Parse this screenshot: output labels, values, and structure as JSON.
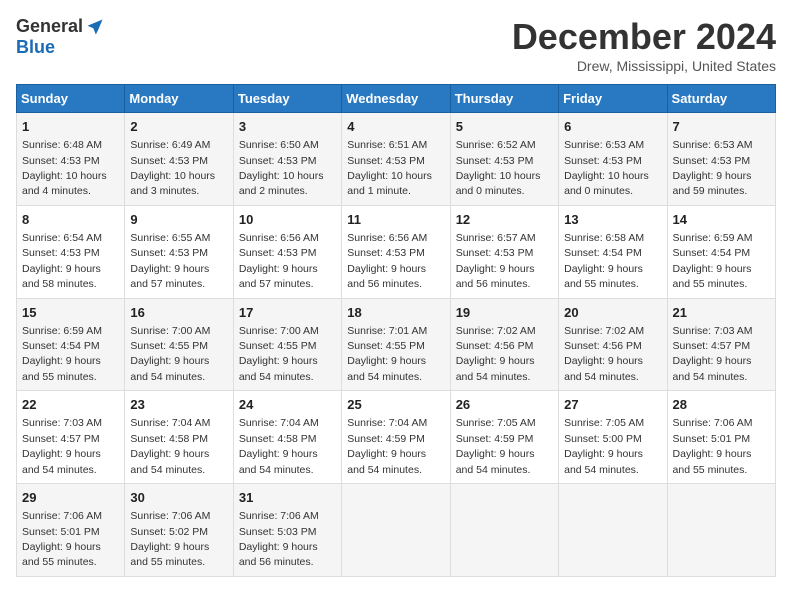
{
  "header": {
    "logo_general": "General",
    "logo_blue": "Blue",
    "month_title": "December 2024",
    "location": "Drew, Mississippi, United States"
  },
  "days_of_week": [
    "Sunday",
    "Monday",
    "Tuesday",
    "Wednesday",
    "Thursday",
    "Friday",
    "Saturday"
  ],
  "weeks": [
    [
      {
        "day": "1",
        "sunrise": "6:48 AM",
        "sunset": "4:53 PM",
        "daylight": "10 hours and 4 minutes."
      },
      {
        "day": "2",
        "sunrise": "6:49 AM",
        "sunset": "4:53 PM",
        "daylight": "10 hours and 3 minutes."
      },
      {
        "day": "3",
        "sunrise": "6:50 AM",
        "sunset": "4:53 PM",
        "daylight": "10 hours and 2 minutes."
      },
      {
        "day": "4",
        "sunrise": "6:51 AM",
        "sunset": "4:53 PM",
        "daylight": "10 hours and 1 minute."
      },
      {
        "day": "5",
        "sunrise": "6:52 AM",
        "sunset": "4:53 PM",
        "daylight": "10 hours and 0 minutes."
      },
      {
        "day": "6",
        "sunrise": "6:53 AM",
        "sunset": "4:53 PM",
        "daylight": "10 hours and 0 minutes."
      },
      {
        "day": "7",
        "sunrise": "6:53 AM",
        "sunset": "4:53 PM",
        "daylight": "9 hours and 59 minutes."
      }
    ],
    [
      {
        "day": "8",
        "sunrise": "6:54 AM",
        "sunset": "4:53 PM",
        "daylight": "9 hours and 58 minutes."
      },
      {
        "day": "9",
        "sunrise": "6:55 AM",
        "sunset": "4:53 PM",
        "daylight": "9 hours and 57 minutes."
      },
      {
        "day": "10",
        "sunrise": "6:56 AM",
        "sunset": "4:53 PM",
        "daylight": "9 hours and 57 minutes."
      },
      {
        "day": "11",
        "sunrise": "6:56 AM",
        "sunset": "4:53 PM",
        "daylight": "9 hours and 56 minutes."
      },
      {
        "day": "12",
        "sunrise": "6:57 AM",
        "sunset": "4:53 PM",
        "daylight": "9 hours and 56 minutes."
      },
      {
        "day": "13",
        "sunrise": "6:58 AM",
        "sunset": "4:54 PM",
        "daylight": "9 hours and 55 minutes."
      },
      {
        "day": "14",
        "sunrise": "6:59 AM",
        "sunset": "4:54 PM",
        "daylight": "9 hours and 55 minutes."
      }
    ],
    [
      {
        "day": "15",
        "sunrise": "6:59 AM",
        "sunset": "4:54 PM",
        "daylight": "9 hours and 55 minutes."
      },
      {
        "day": "16",
        "sunrise": "7:00 AM",
        "sunset": "4:55 PM",
        "daylight": "9 hours and 54 minutes."
      },
      {
        "day": "17",
        "sunrise": "7:00 AM",
        "sunset": "4:55 PM",
        "daylight": "9 hours and 54 minutes."
      },
      {
        "day": "18",
        "sunrise": "7:01 AM",
        "sunset": "4:55 PM",
        "daylight": "9 hours and 54 minutes."
      },
      {
        "day": "19",
        "sunrise": "7:02 AM",
        "sunset": "4:56 PM",
        "daylight": "9 hours and 54 minutes."
      },
      {
        "day": "20",
        "sunrise": "7:02 AM",
        "sunset": "4:56 PM",
        "daylight": "9 hours and 54 minutes."
      },
      {
        "day": "21",
        "sunrise": "7:03 AM",
        "sunset": "4:57 PM",
        "daylight": "9 hours and 54 minutes."
      }
    ],
    [
      {
        "day": "22",
        "sunrise": "7:03 AM",
        "sunset": "4:57 PM",
        "daylight": "9 hours and 54 minutes."
      },
      {
        "day": "23",
        "sunrise": "7:04 AM",
        "sunset": "4:58 PM",
        "daylight": "9 hours and 54 minutes."
      },
      {
        "day": "24",
        "sunrise": "7:04 AM",
        "sunset": "4:58 PM",
        "daylight": "9 hours and 54 minutes."
      },
      {
        "day": "25",
        "sunrise": "7:04 AM",
        "sunset": "4:59 PM",
        "daylight": "9 hours and 54 minutes."
      },
      {
        "day": "26",
        "sunrise": "7:05 AM",
        "sunset": "4:59 PM",
        "daylight": "9 hours and 54 minutes."
      },
      {
        "day": "27",
        "sunrise": "7:05 AM",
        "sunset": "5:00 PM",
        "daylight": "9 hours and 54 minutes."
      },
      {
        "day": "28",
        "sunrise": "7:06 AM",
        "sunset": "5:01 PM",
        "daylight": "9 hours and 55 minutes."
      }
    ],
    [
      {
        "day": "29",
        "sunrise": "7:06 AM",
        "sunset": "5:01 PM",
        "daylight": "9 hours and 55 minutes."
      },
      {
        "day": "30",
        "sunrise": "7:06 AM",
        "sunset": "5:02 PM",
        "daylight": "9 hours and 55 minutes."
      },
      {
        "day": "31",
        "sunrise": "7:06 AM",
        "sunset": "5:03 PM",
        "daylight": "9 hours and 56 minutes."
      },
      null,
      null,
      null,
      null
    ]
  ]
}
